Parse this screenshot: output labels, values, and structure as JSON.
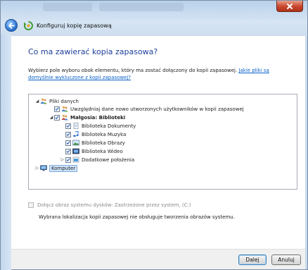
{
  "window": {
    "title": "Konfiguruj kopię zapasową",
    "close_glyph": "x"
  },
  "page": {
    "heading": "Co ma zawierać kopia zapasowa?",
    "description": "Wybierz pole wyboru obok elementu, który ma zostać dołączony do kopii zapasowej.",
    "link": "Jakie pliki są domyślnie wykluczone z kopii zapasowej?"
  },
  "tree": {
    "items": [
      {
        "label": "Pliki danych",
        "checkbox": false,
        "icon": "users-icon",
        "expander": "open",
        "bold": false
      },
      {
        "label": "Uwzględniaj dane nowo utworzonych użytkowników w kopii zapasowej",
        "checkbox": true,
        "icon": "users-icon",
        "expander": "none",
        "bold": false
      },
      {
        "label": "Małgosia: Biblioteki",
        "checkbox": true,
        "icon": "user-icon",
        "expander": "open",
        "bold": true
      },
      {
        "label": "Biblioteka Dokumenty",
        "checkbox": true,
        "icon": "documents-icon",
        "expander": "none",
        "bold": false
      },
      {
        "label": "Biblioteka Muzyka",
        "checkbox": true,
        "icon": "music-icon",
        "expander": "none",
        "bold": false
      },
      {
        "label": "Biblioteka Obrazy",
        "checkbox": true,
        "icon": "pictures-icon",
        "expander": "none",
        "bold": false
      },
      {
        "label": "Biblioteka Wideo",
        "checkbox": true,
        "icon": "video-icon",
        "expander": "none",
        "bold": false
      },
      {
        "label": "Dodatkowe położenia",
        "checkbox": true,
        "icon": "folder-icon",
        "expander": "closed",
        "bold": false
      },
      {
        "label": "Komputer",
        "checkbox": false,
        "icon": "computer-icon",
        "expander": "closed",
        "bold": false
      }
    ]
  },
  "system_image": {
    "label": "Dołącz obraz systemu dysków: Zastrzeżone przez system, (C:)",
    "checked": false,
    "enabled": false
  },
  "notice": "Wybrana lokalizacja kopii zapasowej nie obsługuje tworzenia obrazów systemu.",
  "buttons": {
    "next": "Dalej",
    "cancel": "Anuluj"
  },
  "colors": {
    "heading": "#1e3f9b",
    "link": "#0a60c8",
    "close_button": "#c8452c"
  }
}
